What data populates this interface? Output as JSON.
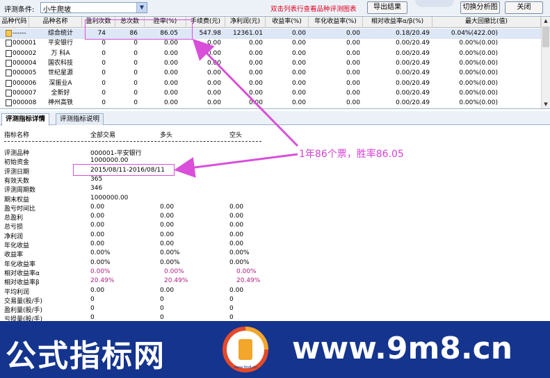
{
  "toolbar": {
    "condition_label": "评测条件:",
    "condition_value": "小牛爬坡",
    "hint": "双击列表行查看品种评测图表",
    "export_label": "导出结果",
    "switch_label": "切换分析图",
    "close_label": "关闭"
  },
  "table": {
    "headers": [
      "品种代码",
      "品种名称",
      "盈利次数",
      "总次数",
      "胜率(%)",
      "手续费(元)",
      "净利润(元)",
      "收益率(%)",
      "年化收益率(%)",
      "相对收益率α/β(%)",
      "最大回撤比(值)"
    ],
    "rows": [
      {
        "code": "------",
        "name": "综合统计",
        "wins": "74",
        "total": "86",
        "rate": "86.05",
        "fee": "547.98",
        "profit": "12361.01",
        "ret": "0.00",
        "annual": "0.00",
        "rel": "0.18/20.49",
        "dd": "0.04%(422.00)"
      },
      {
        "code": "000001",
        "name": "平安银行",
        "wins": "0",
        "total": "0",
        "rate": "0.00",
        "fee": "0.00",
        "profit": "0.00",
        "ret": "0.00",
        "annual": "0.00",
        "rel": "0.00/20.49",
        "dd": "0.00%(0.00)"
      },
      {
        "code": "000002",
        "name": "万 科A",
        "wins": "0",
        "total": "0",
        "rate": "0.00",
        "fee": "0.00",
        "profit": "0.00",
        "ret": "0.00",
        "annual": "0.00",
        "rel": "0.00/20.49",
        "dd": "0.00%(0.00)"
      },
      {
        "code": "000004",
        "name": "国农科技",
        "wins": "0",
        "total": "0",
        "rate": "0.00",
        "fee": "0.00",
        "profit": "0.00",
        "ret": "0.00",
        "annual": "0.00",
        "rel": "0.00/20.49",
        "dd": "0.00%(0.00)"
      },
      {
        "code": "000005",
        "name": "世纪星源",
        "wins": "0",
        "total": "0",
        "rate": "0.00",
        "fee": "0.00",
        "profit": "0.00",
        "ret": "0.00",
        "annual": "0.00",
        "rel": "0.00/20.49",
        "dd": "0.00%(0.00)"
      },
      {
        "code": "000006",
        "name": "深振业A",
        "wins": "0",
        "total": "0",
        "rate": "0.00",
        "fee": "0.00",
        "profit": "0.00",
        "ret": "0.00",
        "annual": "0.00",
        "rel": "0.00/20.49",
        "dd": "0.00%(0.00)"
      },
      {
        "code": "000007",
        "name": "全新好",
        "wins": "0",
        "total": "0",
        "rate": "0.00",
        "fee": "0.00",
        "profit": "0.00",
        "ret": "0.00",
        "annual": "0.00",
        "rel": "0.00/20.49",
        "dd": "0.00%(0.00)"
      },
      {
        "code": "000008",
        "name": "神州高铁",
        "wins": "0",
        "total": "0",
        "rate": "0.00",
        "fee": "0.00",
        "profit": "0.00",
        "ret": "0.00",
        "annual": "0.00",
        "rel": "0.00/20.49",
        "dd": "0.00%(0.00)"
      }
    ]
  },
  "tabs": {
    "detail": "评测指标详情",
    "desc": "评测指标说明"
  },
  "detail": {
    "headers": {
      "name": "指标名称",
      "all": "全部交易",
      "long": "多头",
      "short": "空头"
    },
    "info": [
      {
        "label": "评测品种",
        "value": "000001-平安银行"
      },
      {
        "label": "初始资金",
        "value": "1000000.00"
      },
      {
        "label": "评测日期",
        "value": "2015/08/11-2016/08/11"
      },
      {
        "label": "有效天数",
        "value": "365"
      },
      {
        "label": "评测周期数",
        "value": "346"
      },
      {
        "label": "期末权益",
        "value": "1000000.00"
      }
    ],
    "metrics": [
      {
        "label": "盈亏时间比",
        "all": "0.00",
        "long": "0.00",
        "short": "0.00"
      },
      {
        "label": "总盈利",
        "all": "0.00",
        "long": "0.00",
        "short": "0.00"
      },
      {
        "label": "总亏损",
        "all": "0.00",
        "long": "0.00",
        "short": "0.00"
      },
      {
        "label": "净利润",
        "all": "0.00",
        "long": "0.00",
        "short": "0.00"
      },
      {
        "label": "年化收益",
        "all": "0.00",
        "long": "0.00",
        "short": "0.00"
      },
      {
        "label": "收益率",
        "all": "0.00%",
        "long": "0.00%",
        "short": "0.00%"
      },
      {
        "label": "年化收益率",
        "all": "0.00%",
        "long": "0.00%",
        "short": "0.00%"
      },
      {
        "label": "相对收益率α",
        "all": "0.00%",
        "long": "0.00%",
        "short": "0.00%"
      },
      {
        "label": "相对收益率β",
        "all": "20.49%",
        "long": "20.49%",
        "short": "20.49%"
      },
      {
        "label": "平均利润",
        "all": "0.00",
        "long": "0.00",
        "short": "0.00"
      },
      {
        "label": "交易量(股/手)",
        "all": "0",
        "long": "0",
        "short": "0"
      },
      {
        "label": "盈利量(股/手)",
        "all": "0",
        "long": "0",
        "short": "0"
      },
      {
        "label": "亏损量(股/手)",
        "all": "0",
        "long": "0",
        "short": "0"
      }
    ]
  },
  "annotation": {
    "text": "1年86个票，胜率86.05",
    "color": "#d63fd6"
  },
  "watermark": {
    "left_text": "公式指标网",
    "right_text": "www.9m8.cn",
    "logo_text": "www.9m8.cn"
  },
  "colors": {
    "hint": "#e0001c",
    "alpha_beta": "#b02080",
    "banner": "#14348e"
  }
}
